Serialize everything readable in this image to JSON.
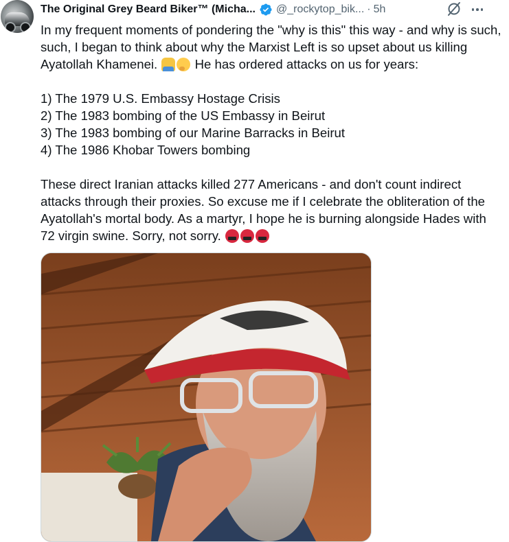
{
  "tweet": {
    "display_name": "The Original Grey Beard Biker™ (Micha...",
    "handle": "@_rockytop_bik...",
    "separator": "·",
    "time": "5h",
    "icons": {
      "verified": "verified-badge-icon",
      "grok": "grok-icon",
      "more": "more-options-icon",
      "emoji_1": "man-shrugging-emoji",
      "emoji_2": "thinking-face-emoji",
      "emoji_3": "face-with-symbols-on-mouth-emoji"
    },
    "colors": {
      "verified": "#1d9bf0",
      "text": "#0f1419",
      "secondary": "#536471"
    },
    "para1_a": "In my frequent moments of pondering the \"why is this\" this way - and why is such, such, I began to think about why the Marxist Left is so upset about us killing Ayatollah Khamenei.",
    "para1_b": "He has ordered attacks on us for years:",
    "list": [
      "1) The 1979 U.S. Embassy Hostage Crisis",
      "2) The 1983 bombing of the US Embassy in Beirut",
      "3) The 1983 bombing of our Marine Barracks in Beirut",
      "4) The 1986 Khobar Towers bombing"
    ],
    "para2": "These direct Iranian attacks killed 277 Americans - and don't count indirect attacks through their proxies. So excuse me if I celebrate the obliteration of the Ayatollah's mortal body. As a martyr, I hope he is burning alongside Hades with 72 virgin swine. Sorry, not sorry."
  }
}
